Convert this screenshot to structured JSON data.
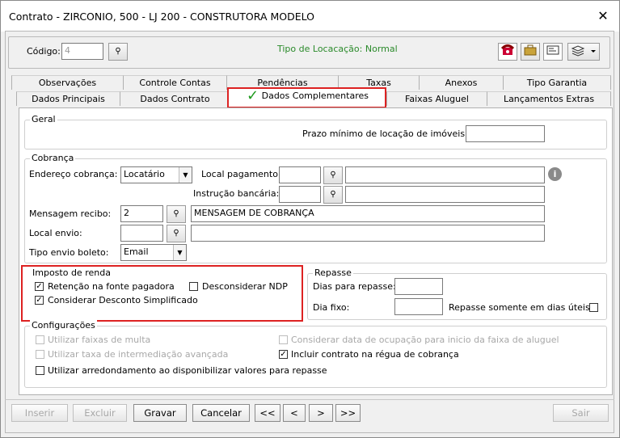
{
  "window": {
    "title": "Contrato - ZIRCONIO, 500 - LJ 200 - CONSTRUTORA MODELO",
    "close": "✕"
  },
  "header": {
    "codigo_label": "Código:",
    "codigo_value": "4",
    "tipo_locacao": "Tipo de Locacação:  Normal"
  },
  "tabs_row1": [
    "Observações",
    "Controle Contas",
    "Pendências",
    "Taxas",
    "Anexos",
    "Tipo Garantia"
  ],
  "tabs_row2": [
    "Dados Principais",
    "Dados Contrato",
    "Dados Complementares",
    "Faixas Aluguel",
    "Lançamentos Extras"
  ],
  "check_mark": "✓",
  "geral": {
    "legend": "Geral",
    "prazo_label": "Prazo mínimo de locação de imóveis:",
    "prazo_value": ""
  },
  "cobranca": {
    "legend": "Cobrança",
    "endereco_label": "Endereço cobrança:",
    "endereco_value": "Locatário",
    "local_pag_label": "Local pagamento:",
    "local_pag_value": "",
    "instrucao_label": "Instrução bancária:",
    "instrucao_value": "",
    "mensagem_label": "Mensagem recibo:",
    "mensagem_code": "2",
    "mensagem_text": "MENSAGEM DE COBRANÇA",
    "local_envio_label": "Local envio:",
    "tipo_envio_label": "Tipo envio boleto:",
    "tipo_envio_value": "Email"
  },
  "imposto": {
    "legend": "Imposto de renda",
    "retencao": "Retenção na fonte pagadora",
    "desconsiderar": "Desconsiderar NDP",
    "considerar": "Considerar Desconto Simplificado"
  },
  "repasse": {
    "legend": "Repasse",
    "dias_label": "Dias para repasse:",
    "dia_fixo_label": "Dia fixo:",
    "somente_label": "Repasse somente em dias úteis"
  },
  "config": {
    "legend": "Configurações",
    "multa": "Utilizar faixas de multa",
    "taxa": "Utilizar taxa de intermediação avançada",
    "arredondamento": "Utilizar arredondamento ao disponibilizar valores para repasse",
    "data_ocupacao": "Considerar data de ocupação para inicio da faixa de aluguel",
    "regua": "Incluir contrato na régua de cobrança"
  },
  "buttons": {
    "inserir": "Inserir",
    "excluir": "Excluir",
    "gravar": "Gravar",
    "cancelar": "Cancelar",
    "first": "<<",
    "prev": "<",
    "next": ">",
    "last": ">>",
    "sair": "Sair"
  }
}
